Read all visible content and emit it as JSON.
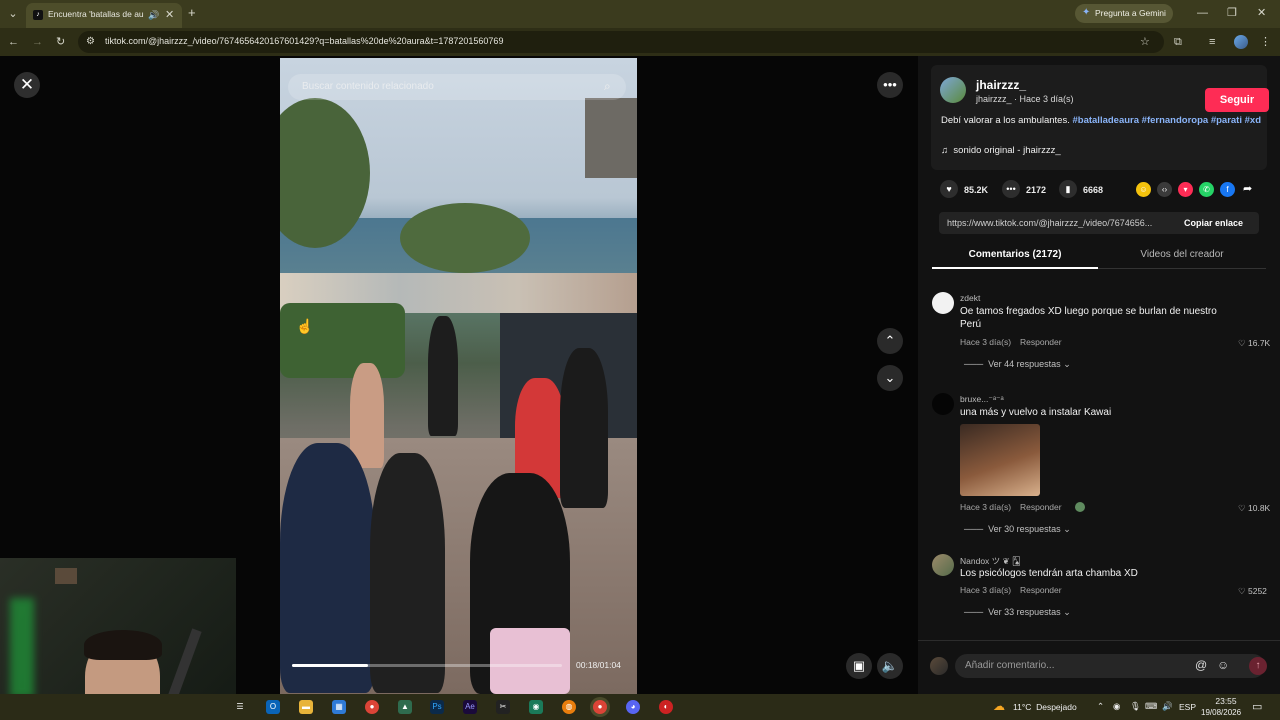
{
  "browser": {
    "tab_title": "Encuentra 'batallas de aura",
    "url": "tiktok.com/@jhairzzz_/video/7674656420167601429?q=batallas%20de%20aura&t=1787201560769",
    "gemini_label": "Pregunta a Gemini"
  },
  "video": {
    "search_placeholder": "Buscar contenido relacionado",
    "time": "00:18/01:04",
    "progress": 0.28
  },
  "author": {
    "username": "jhairzzz_",
    "subline": "jhairzzz_ · Hace 3 día(s)",
    "follow_label": "Seguir",
    "caption": "Debí valorar a los ambulantes.",
    "hashtags": [
      "#batalladeaura",
      "#fernandoropa",
      "#parati",
      "#xd"
    ],
    "sound": "sonido original - jhairzzz_"
  },
  "stats": {
    "likes": "85.2K",
    "comments": "2172",
    "saves": "6668"
  },
  "link": {
    "url": "https://www.tiktok.com/@jhairzzz_/video/7674656...",
    "copy_label": "Copiar enlace"
  },
  "tabs": {
    "comments": "Comentarios (2172)",
    "creator_videos": "Videos del creador"
  },
  "comments": [
    {
      "user": "zdekt",
      "text": "Oe tamos fregados XD luego porque se burlan de nuestro Perú",
      "time": "Hace 3 día(s)",
      "reply": "Responder",
      "likes": "16.7K",
      "replies": "Ver 44 respuestas"
    },
    {
      "user": "bruxe...⁻ᵃ⁻ᵃ",
      "text": "una más y vuelvo a instalar Kawai",
      "time": "Hace 3 día(s)",
      "reply": "Responder",
      "likes": "10.8K",
      "replies": "Ver 30 respuestas"
    },
    {
      "user": "Nandox ツ ❦ 🂡",
      "text": "Los psicólogos tendrán arta chamba XD",
      "time": "Hace 3 día(s)",
      "reply": "Responder",
      "likes": "5252",
      "replies": "Ver 33 respuestas"
    }
  ],
  "add_comment_placeholder": "Añadir comentario...",
  "taskbar": {
    "weather": "11°C  Despejado",
    "lang": "ESP",
    "clock_time": "23:55",
    "clock_date": "19/08/2026"
  },
  "colors": {
    "accent": "#fe2c55",
    "hashtag": "#8ab4f8",
    "chrome_bg": "#3b3b1e"
  }
}
